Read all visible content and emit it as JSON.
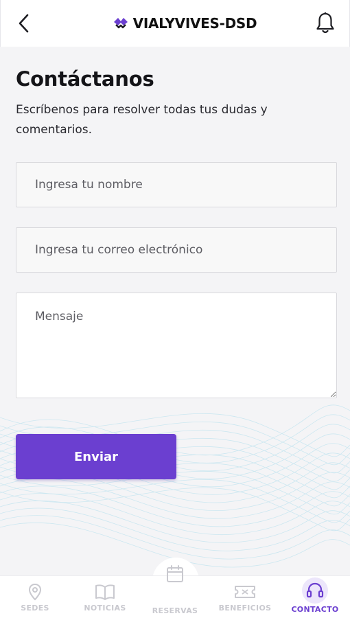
{
  "header": {
    "brand": "VIALYVIVES-DSD",
    "back_icon": "chevron-left-icon",
    "bell_icon": "bell-icon"
  },
  "contact": {
    "title": "Contáctanos",
    "subtitle": "Escríbenos para resolver todas tus dudas y comentarios.",
    "name_placeholder": "Ingresa tu nombre",
    "email_placeholder": "Ingresa tu correo electrónico",
    "message_placeholder": "Mensaje",
    "send_label": "Enviar"
  },
  "nav": {
    "items": [
      {
        "label": "SEDES",
        "icon": "location-pin-icon"
      },
      {
        "label": "NOTICIAS",
        "icon": "book-icon"
      },
      {
        "label": "RESERVAS",
        "icon": "calendar-icon"
      },
      {
        "label": "BENEFICIOS",
        "icon": "ticket-icon"
      },
      {
        "label": "CONTACTO",
        "icon": "headset-icon",
        "active": true
      }
    ]
  },
  "colors": {
    "accent": "#6b3fd0",
    "background": "#f4f4f6",
    "nav_inactive": "#c9c9cf"
  }
}
